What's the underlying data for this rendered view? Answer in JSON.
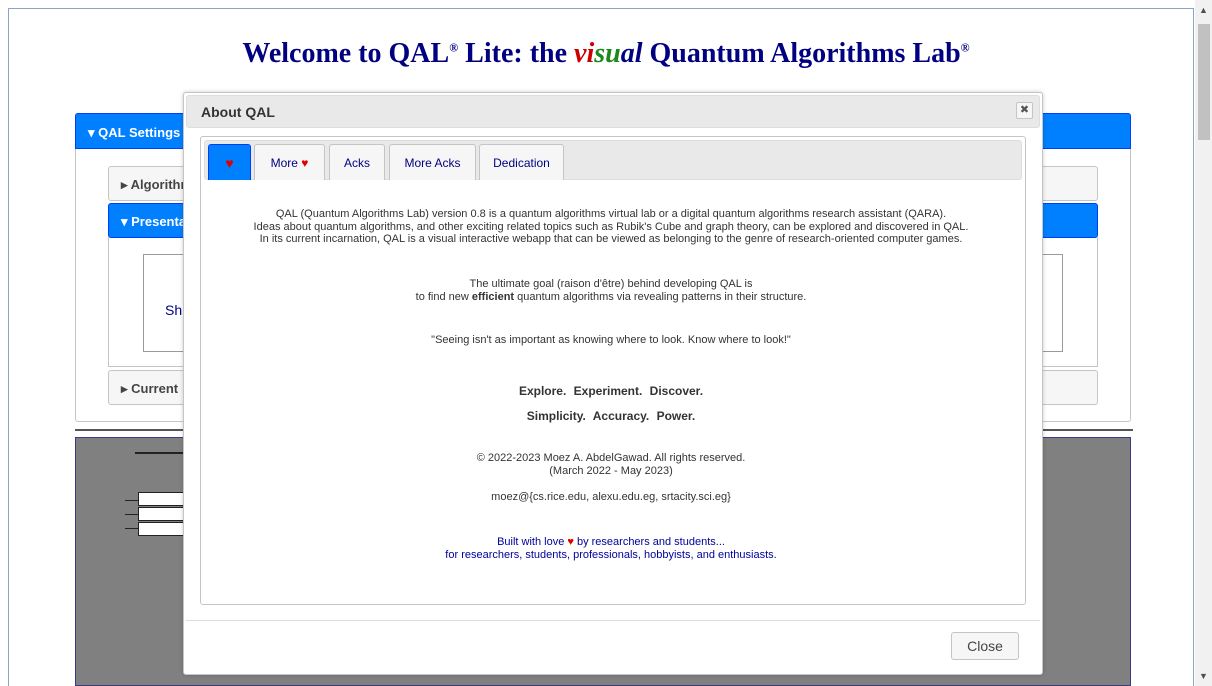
{
  "page": {
    "title_pre": "Welcome to QAL",
    "title_reg1": "®",
    "title_mid": " Lite: the ",
    "title_vi": "vi",
    "title_su": "su",
    "title_al": "al",
    "title_post": " Quantum Algorithms Lab",
    "title_reg2": "®"
  },
  "background": {
    "settings_header": "▾ QAL Settings",
    "acc_algorithm": "▸ Algorithm",
    "acc_presentation": "▾ Presentation",
    "inner_text": "Sh",
    "acc_current": "▸ Current"
  },
  "modal": {
    "title": "About QAL",
    "close_x": "✖",
    "tabs": [
      {
        "label": "",
        "heart": "♥"
      },
      {
        "label": "More ",
        "heart": "♥"
      },
      {
        "label": "Acks"
      },
      {
        "label": "More Acks"
      },
      {
        "label": "Dedication"
      }
    ],
    "para1": [
      "QAL (Quantum Algorithms Lab) version 0.8 is a quantum algorithms virtual lab or a digital quantum algorithms research assistant (QARA).",
      "Ideas about quantum algorithms, and other exciting related topics such as Rubik's Cube and graph theory, can be explored and discovered in QAL.",
      "In its current incarnation, QAL is a visual interactive webapp that can be viewed as belonging to the genre of research-oriented computer games."
    ],
    "goal_line1": "The ultimate goal (raison d'être) behind developing QAL is",
    "goal_line2_pre": "to find new ",
    "goal_line2_bold": "efficient",
    "goal_line2_post": " quantum algorithms via revealing patterns in their structure.",
    "quote": "\"Seeing isn't as important as knowing where to look. Know where to look!\"",
    "motto1": "Explore.  Experiment.  Discover.",
    "motto2": "Simplicity.  Accuracy.  Power.",
    "copyright1": "© 2022-2023 Moez A. AbdelGawad. All rights reserved.",
    "copyright2": "(March 2022 - May 2023)",
    "email": "moez@{cs.rice.edu, alexu.edu.eg, srtacity.sci.eg}",
    "built1_pre": "Built with love ",
    "built1_heart": "♥",
    "built1_post": " by researchers and students...",
    "built2": "for researchers, students, professionals, hobbyists, and enthusiasts.",
    "close_button": "Close"
  },
  "colors": {
    "accent": "#007fff",
    "title_blue": "#000080",
    "heart_red": "#e00000",
    "canvas_gray": "#808080"
  }
}
